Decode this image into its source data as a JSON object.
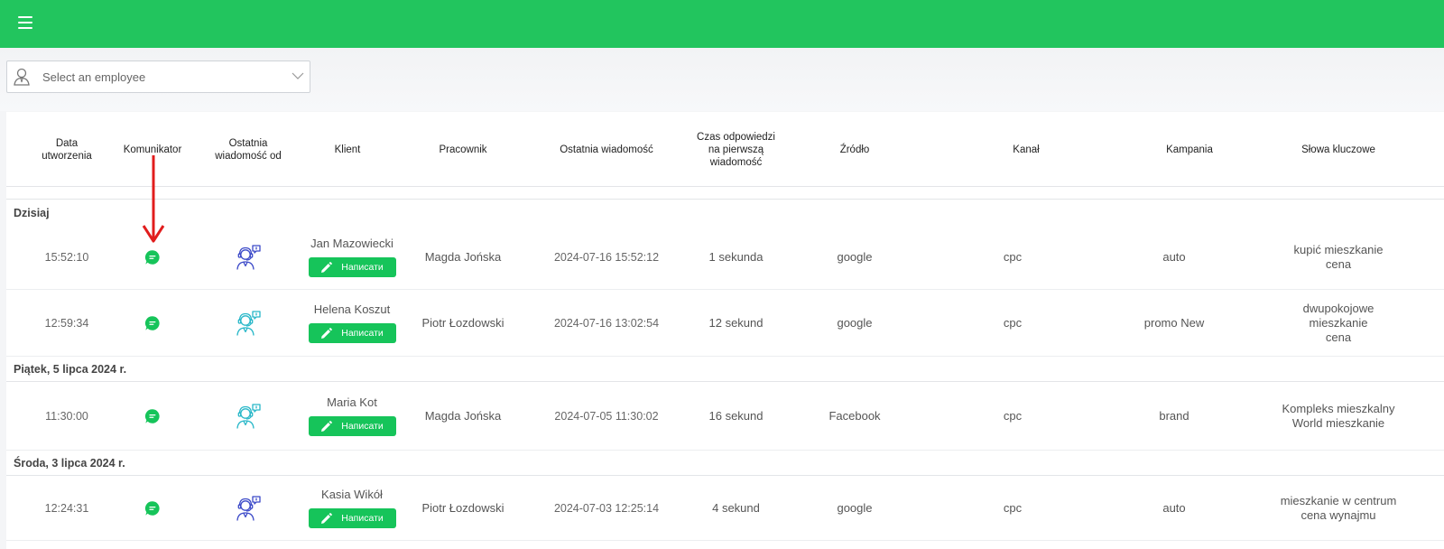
{
  "colors": {
    "topbar": "#22c55e",
    "button": "#16c45a",
    "chat_icon": "#16c45a",
    "agent_icon_blue": "#3b49c8",
    "agent_icon_teal": "#27b7c8",
    "arrow": "#e11d1d"
  },
  "filter": {
    "placeholder": "Select an employee",
    "icon": "user-icon"
  },
  "headers": {
    "created": "Data utworzenia",
    "messenger": "Komunikator",
    "last_from": "Ostatnia wiadomość od",
    "client": "Klient",
    "employee": "Pracownik",
    "last_message": "Ostatnia wiadomość",
    "response_time": "Czas odpowiedzi na pierwszą wiadomość",
    "source": "Źródło",
    "channel": "Kanał",
    "campaign": "Kampania",
    "keywords": "Słowa kluczowe"
  },
  "write_label": "Написати",
  "groups": [
    {
      "label": "Dzisiaj",
      "rows": [
        {
          "time": "15:52:10",
          "last_from_icon": "agent-blue-icon",
          "client": "Jan Mazowiecki",
          "employee": "Magda Jońska",
          "last_message": "2024-07-16 15:52:12",
          "response": "1 sekunda",
          "source": "google",
          "channel": "cpc",
          "campaign": "auto",
          "keywords": [
            "kupić mieszkanie",
            "cena"
          ]
        },
        {
          "time": "12:59:34",
          "last_from_icon": "agent-teal-icon",
          "client": "Helena Koszut",
          "employee": "Piotr Łozdowski",
          "last_message": "2024-07-16 13:02:54",
          "response": "12 sekund",
          "source": "google",
          "channel": "cpc",
          "campaign": "promo New",
          "keywords": [
            "dwupokojowe",
            "mieszkanie",
            "cena"
          ]
        }
      ]
    },
    {
      "label": "Piątek, 5 lipca 2024 r.",
      "rows": [
        {
          "time": "11:30:00",
          "last_from_icon": "agent-teal-icon",
          "client": "Maria Kot",
          "employee": "Magda Jońska",
          "last_message": "2024-07-05 11:30:02",
          "response": "16 sekund",
          "source": "Facebook",
          "channel": "cpc",
          "campaign": "brand",
          "keywords": [
            "Kompleks mieszkalny",
            "World mieszkanie"
          ]
        }
      ]
    },
    {
      "label": "Środa, 3 lipca 2024 r.",
      "rows": [
        {
          "time": "12:24:31",
          "last_from_icon": "agent-blue-icon",
          "client": "Kasia Wikół",
          "employee": "Piotr Łozdowski",
          "last_message": "2024-07-03 12:25:14",
          "response": "4 sekund",
          "source": "google",
          "channel": "cpc",
          "campaign": "auto",
          "keywords": [
            "mieszkanie w centrum",
            "cena wynajmu"
          ]
        }
      ]
    }
  ]
}
